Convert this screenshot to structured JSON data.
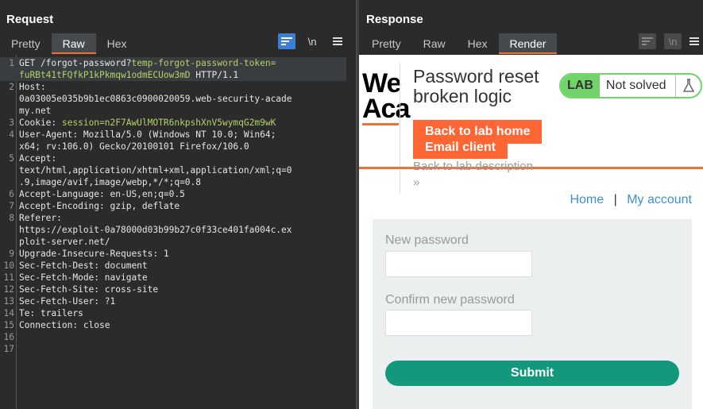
{
  "request": {
    "title": "Request",
    "tabs": [
      "Pretty",
      "Raw",
      "Hex"
    ],
    "active_tab": "Raw",
    "tool_wrap": "≡",
    "tool_newline": "\\n",
    "tool_menu": "☰",
    "lines": [
      {
        "n": "1",
        "parts": [
          [
            "key",
            "GET /forgot-password?"
          ],
          [
            "grn",
            "temp-forgot-password-token="
          ]
        ]
      },
      {
        "n": "",
        "parts": [
          [
            "grn",
            "fuRBt41tFQfkP1kPkmqw1odmECUow3mD"
          ],
          [
            "key",
            " HTTP/1.1"
          ]
        ]
      },
      {
        "n": "2",
        "parts": [
          [
            "key",
            "Host:"
          ]
        ]
      },
      {
        "n": "",
        "parts": [
          [
            "key",
            "0a03005e035b9b1ec0863c0900020059.web-security-acade"
          ]
        ]
      },
      {
        "n": "",
        "parts": [
          [
            "key",
            "my.net"
          ]
        ]
      },
      {
        "n": "3",
        "parts": [
          [
            "key",
            "Cookie: "
          ],
          [
            "grn",
            "session=n2F7AwUlMOTR6nkpshXnV5wymqG2m9wK"
          ]
        ]
      },
      {
        "n": "4",
        "parts": [
          [
            "key",
            "User-Agent: Mozilla/5.0 (Windows NT 10.0; Win64;"
          ]
        ]
      },
      {
        "n": "",
        "parts": [
          [
            "key",
            "x64; rv:106.0) Gecko/20100101 Firefox/106.0"
          ]
        ]
      },
      {
        "n": "5",
        "parts": [
          [
            "key",
            "Accept:"
          ]
        ]
      },
      {
        "n": "",
        "parts": [
          [
            "key",
            "text/html,application/xhtml+xml,application/xml;q=0"
          ]
        ]
      },
      {
        "n": "",
        "parts": [
          [
            "key",
            ".9,image/avif,image/webp,*/*;q=0.8"
          ]
        ]
      },
      {
        "n": "6",
        "parts": [
          [
            "key",
            "Accept-Language: en-US,en;q=0.5"
          ]
        ]
      },
      {
        "n": "7",
        "parts": [
          [
            "key",
            "Accept-Encoding: gzip, deflate"
          ]
        ]
      },
      {
        "n": "8",
        "parts": [
          [
            "key",
            "Referer:"
          ]
        ]
      },
      {
        "n": "",
        "parts": [
          [
            "key",
            "https://exploit-0a78000d03b99b27c0f33ce401fa004c.ex"
          ]
        ]
      },
      {
        "n": "",
        "parts": [
          [
            "key",
            "ploit-server.net/"
          ]
        ]
      },
      {
        "n": "9",
        "parts": [
          [
            "key",
            "Upgrade-Insecure-Requests: 1"
          ]
        ]
      },
      {
        "n": "10",
        "parts": [
          [
            "key",
            "Sec-Fetch-Dest: document"
          ]
        ]
      },
      {
        "n": "11",
        "parts": [
          [
            "key",
            "Sec-Fetch-Mode: navigate"
          ]
        ]
      },
      {
        "n": "12",
        "parts": [
          [
            "key",
            "Sec-Fetch-Site: cross-site"
          ]
        ]
      },
      {
        "n": "13",
        "parts": [
          [
            "key",
            "Sec-Fetch-User: ?1"
          ]
        ]
      },
      {
        "n": "14",
        "parts": [
          [
            "key",
            "Te: trailers"
          ]
        ]
      },
      {
        "n": "15",
        "parts": [
          [
            "key",
            "Connection: close"
          ]
        ]
      },
      {
        "n": "16",
        "parts": []
      },
      {
        "n": "17",
        "parts": []
      }
    ]
  },
  "response": {
    "title": "Response",
    "tabs": [
      "Pretty",
      "Raw",
      "Hex",
      "Render"
    ],
    "active_tab": "Render",
    "tool_wrap": "≡",
    "tool_newline": "\\n",
    "tool_menu": "☰",
    "render": {
      "logo_line1": "We",
      "logo_line2": "Aca",
      "lab_title_line1": "Password reset",
      "lab_title_line2": "broken logic",
      "badge_lab": "LAB",
      "badge_status": "Not solved",
      "back_home": "Back to lab home",
      "email_client": "Email client",
      "back_desc": "Back to lab description",
      "chevrons": "»",
      "nav_home": "Home",
      "nav_sep": "|",
      "nav_account": "My account",
      "new_password_label": "New password",
      "confirm_password_label": "Confirm new password",
      "submit": "Submit"
    }
  },
  "colors": {
    "accent_blue": "#3e7fd6",
    "burp_orange": "#e8743b",
    "lab_orange": "#ff6633",
    "badge_green": "#70d46b",
    "submit_teal": "#13987c",
    "token_green": "#b5d169"
  }
}
